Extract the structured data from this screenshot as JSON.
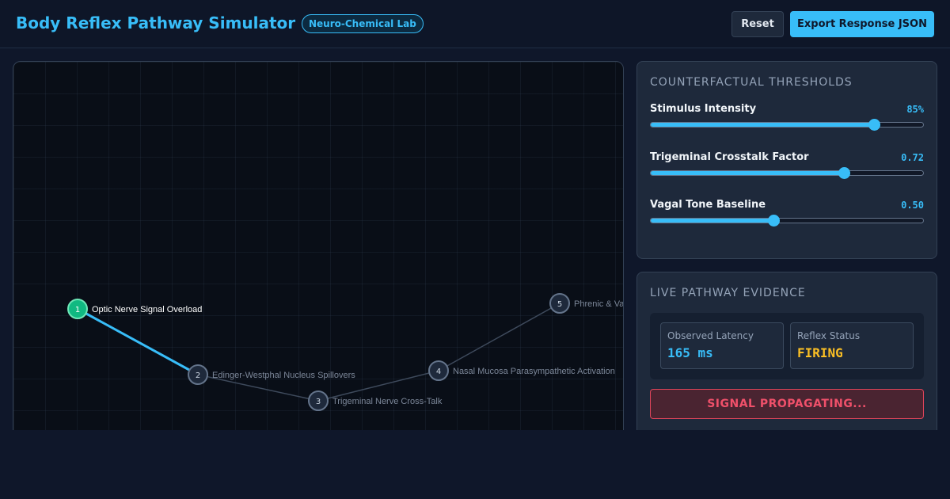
{
  "header": {
    "title": "Body Reflex Pathway Simulator",
    "badge": "Neuro-Chemical Lab",
    "reset_label": "Reset",
    "export_label": "Export Response JSON"
  },
  "pathway": {
    "nodes": [
      {
        "id": "1",
        "label": "Optic Nerve Signal Overload",
        "state": "active"
      },
      {
        "id": "2",
        "label": "Edinger-Westphal Nucleus Spillovers",
        "state": "idle"
      },
      {
        "id": "3",
        "label": "Trigeminal Nerve Cross-Talk",
        "state": "idle"
      },
      {
        "id": "4",
        "label": "Nasal Mucosa Parasympathetic Activation",
        "state": "idle"
      },
      {
        "id": "5",
        "label": "Phrenic & Vagus",
        "state": "idle"
      }
    ],
    "edges": [
      {
        "from": "1",
        "to": "2",
        "active": true
      },
      {
        "from": "2",
        "to": "3",
        "active": false
      },
      {
        "from": "3",
        "to": "4",
        "active": false
      },
      {
        "from": "4",
        "to": "5",
        "active": false
      }
    ]
  },
  "thresholds": {
    "title": "COUNTERFACTUAL THRESHOLDS",
    "sliders": [
      {
        "label": "Stimulus Intensity",
        "value_text": "85%",
        "fraction": 0.82
      },
      {
        "label": "Trigeminal Crosstalk Factor",
        "value_text": "0.72",
        "fraction": 0.71
      },
      {
        "label": "Vagal Tone Baseline",
        "value_text": "0.50",
        "fraction": 0.45
      }
    ]
  },
  "evidence": {
    "title": "LIVE PATHWAY EVIDENCE",
    "latency_label": "Observed Latency",
    "latency_value": "165 ms",
    "status_label": "Reflex Status",
    "status_value": "FIRING",
    "banner": "SIGNAL PROPAGATING..."
  },
  "colors": {
    "accent": "#38bdf8",
    "active_node": "#10b981",
    "idle_node": "#1e293b",
    "firing": "#fbbf24",
    "alert": "#f0506a"
  }
}
